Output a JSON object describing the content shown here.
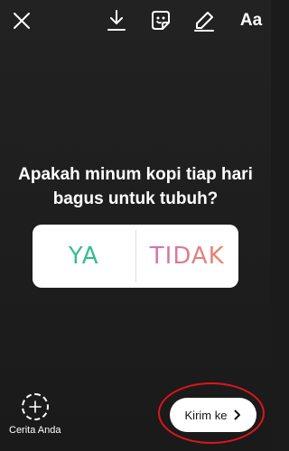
{
  "toolbar": {
    "close_icon": "close-icon",
    "download_icon": "download-icon",
    "sticker_icon": "sticker-icon",
    "draw_icon": "pen-icon",
    "text_label": "Aa"
  },
  "poll": {
    "question": "Apakah minum kopi tiap hari bagus untuk tubuh?",
    "options": [
      "YA",
      "TIDAK"
    ],
    "colors": {
      "yes_start": "#3fc7b0",
      "yes_end": "#27b36b",
      "no_start": "#c970c8",
      "no_end": "#ec8a55"
    }
  },
  "footer": {
    "story_label": "Cerita Anda",
    "send_label": "Kirim ke",
    "highlight_color": "#e0141c"
  }
}
